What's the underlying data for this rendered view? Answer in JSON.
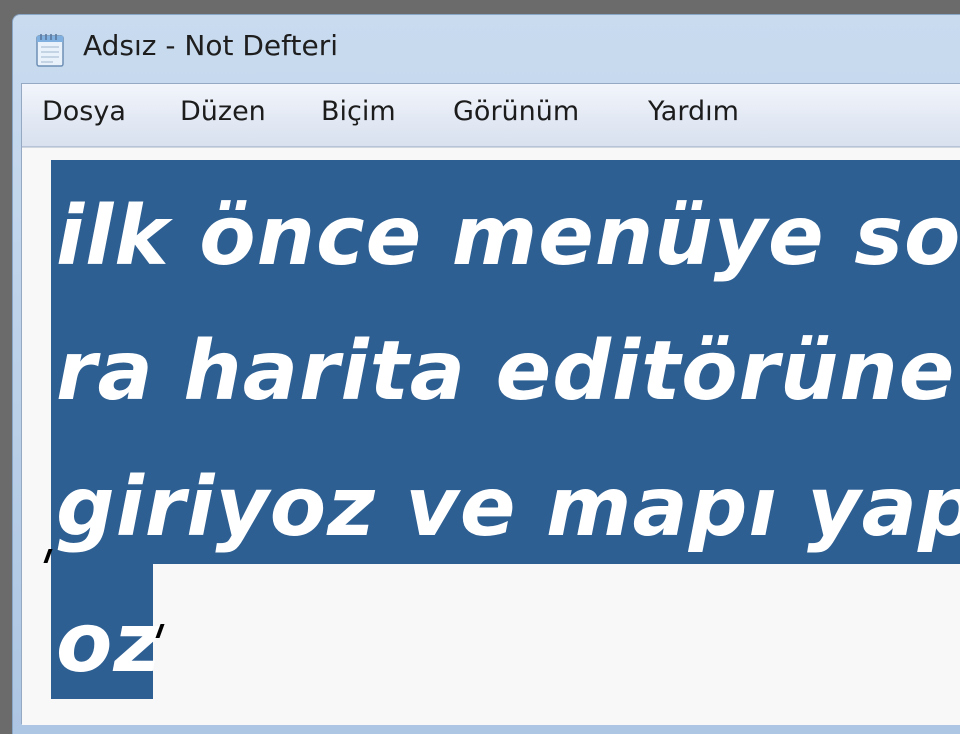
{
  "window": {
    "title": "Adsız - Not Defteri",
    "icon": "notepad-icon"
  },
  "menu": {
    "items": [
      "Dosya",
      "Düzen",
      "Biçim",
      "Görünüm",
      "Yardım"
    ]
  },
  "document": {
    "lines": [
      "ilk önce menüye son",
      "ra harita editörüne",
      "giriyoz ve mapı yap",
      "oz"
    ],
    "selection": "full text selected"
  },
  "colors": {
    "selection_bg": "#2d5f93",
    "selection_text": "#ffffff",
    "titlebar": "#b9cfe8",
    "menubar": "#e3e9f4"
  }
}
